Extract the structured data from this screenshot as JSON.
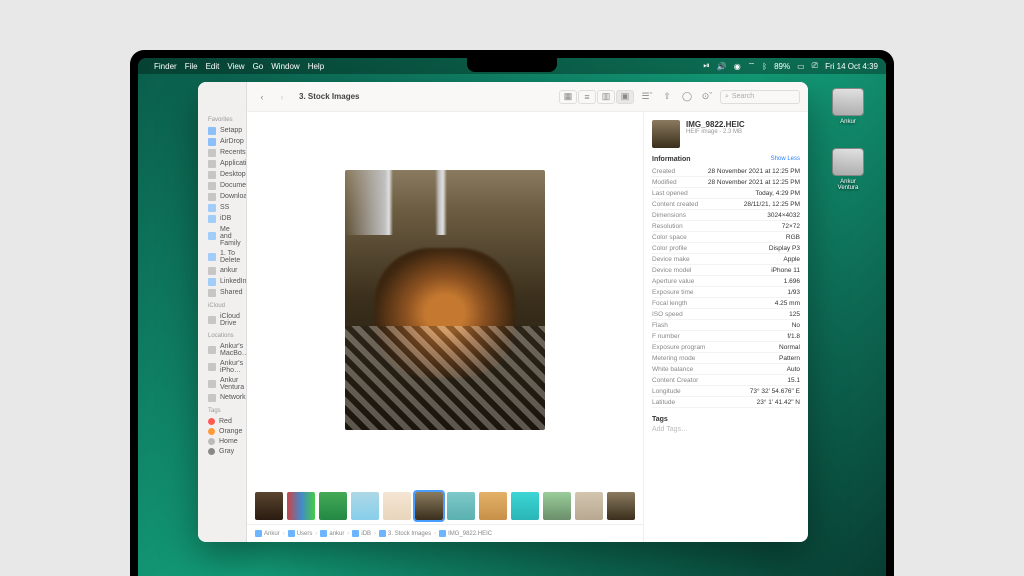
{
  "menubar": {
    "app": "Finder",
    "items": [
      "File",
      "Edit",
      "View",
      "Go",
      "Window",
      "Help"
    ],
    "battery": "89%",
    "datetime": "Fri 14 Oct  4:39"
  },
  "drives": [
    {
      "label": "Ankur"
    },
    {
      "label": "Ankur Ventura"
    }
  ],
  "toolbar": {
    "title": "3. Stock Images",
    "search_placeholder": "Search"
  },
  "sidebar": {
    "sections": [
      {
        "title": "Favorites",
        "items": [
          {
            "label": "Setapp",
            "icon": "blue"
          },
          {
            "label": "AirDrop",
            "icon": "blue"
          },
          {
            "label": "Recents",
            "icon": "gray"
          },
          {
            "label": "Applications",
            "icon": "gray"
          },
          {
            "label": "Desktop",
            "icon": "gray"
          },
          {
            "label": "Documents",
            "icon": "gray"
          },
          {
            "label": "Downloads",
            "icon": "gray"
          },
          {
            "label": "SS",
            "icon": "folder"
          },
          {
            "label": "iDB",
            "icon": "folder"
          },
          {
            "label": "Me and Family",
            "icon": "folder"
          },
          {
            "label": "1. To Delete",
            "icon": "folder"
          },
          {
            "label": "ankur",
            "icon": "gray"
          },
          {
            "label": "LinkedIn",
            "icon": "folder"
          },
          {
            "label": "Shared",
            "icon": "gray"
          }
        ]
      },
      {
        "title": "iCloud",
        "items": [
          {
            "label": "iCloud Drive",
            "icon": "gray"
          }
        ]
      },
      {
        "title": "Locations",
        "items": [
          {
            "label": "Ankur's MacBo…",
            "icon": "gray"
          },
          {
            "label": "Ankur's iPho…",
            "icon": "gray"
          },
          {
            "label": "Ankur Ventura",
            "icon": "gray"
          },
          {
            "label": "Network",
            "icon": "gray"
          }
        ]
      },
      {
        "title": "Tags",
        "items": [
          {
            "label": "Red",
            "tag": "#ff5b52"
          },
          {
            "label": "Orange",
            "tag": "#ff9a3a"
          },
          {
            "label": "Home",
            "tag": "#bbb"
          },
          {
            "label": "Gray",
            "tag": "#888"
          }
        ]
      }
    ]
  },
  "file": {
    "name": "IMG_9822.HEIC",
    "subtitle": "HEIF image - 2.3 MB",
    "info_title": "Information",
    "show_less": "Show Less",
    "rows": [
      {
        "k": "Created",
        "v": "28 November 2021 at 12:25 PM"
      },
      {
        "k": "Modified",
        "v": "28 November 2021 at 12:25 PM"
      },
      {
        "k": "Last opened",
        "v": "Today, 4:29 PM"
      },
      {
        "k": "Content created",
        "v": "28/11/21, 12:25 PM"
      },
      {
        "k": "Dimensions",
        "v": "3024×4032"
      },
      {
        "k": "Resolution",
        "v": "72×72"
      },
      {
        "k": "Color space",
        "v": "RGB"
      },
      {
        "k": "Color profile",
        "v": "Display P3"
      },
      {
        "k": "Device make",
        "v": "Apple"
      },
      {
        "k": "Device model",
        "v": "iPhone 11"
      },
      {
        "k": "Aperture value",
        "v": "1.696"
      },
      {
        "k": "Exposure time",
        "v": "1/93"
      },
      {
        "k": "Focal length",
        "v": "4.25 mm"
      },
      {
        "k": "ISO speed",
        "v": "125"
      },
      {
        "k": "Flash",
        "v": "No"
      },
      {
        "k": "F number",
        "v": "f/1.8"
      },
      {
        "k": "Exposure program",
        "v": "Normal"
      },
      {
        "k": "Metering mode",
        "v": "Pattern"
      },
      {
        "k": "White balance",
        "v": "Auto"
      },
      {
        "k": "Content Creator",
        "v": "15.1"
      },
      {
        "k": "Longitude",
        "v": "73° 32' 54.676\" E"
      },
      {
        "k": "Latitude",
        "v": "23° 1' 41.42\" N"
      }
    ],
    "tags_title": "Tags",
    "tags_placeholder": "Add Tags…"
  },
  "pathbar": [
    "Ankur",
    "Users",
    "ankur",
    "iDB",
    "3. Stock Images",
    "IMG_9822.HEIC"
  ],
  "thumbs": [
    {
      "c": "linear-gradient(#5a4530,#2a1c10)"
    },
    {
      "c": "linear-gradient(90deg,#c44,#48c,#4c4)"
    },
    {
      "c": "linear-gradient(#4a5,#284)"
    },
    {
      "c": "linear-gradient(#add8e6,#87ceeb)"
    },
    {
      "c": "linear-gradient(#f5e6d3,#e8d5bc)"
    },
    {
      "c": "linear-gradient(#8a7a5f,#3a2f1c)",
      "sel": true
    },
    {
      "c": "linear-gradient(#7ec8c8,#5ab0b0)"
    },
    {
      "c": "linear-gradient(#e4b169,#c89048)"
    },
    {
      "c": "linear-gradient(#3dd6d6,#2ab5b5)"
    },
    {
      "c": "linear-gradient(#9acd9a,#6b8e6b)"
    },
    {
      "c": "linear-gradient(#d4c5b0,#b8a890)"
    },
    {
      "c": "linear-gradient(#8a7a5f,#3a2f1c)"
    }
  ]
}
